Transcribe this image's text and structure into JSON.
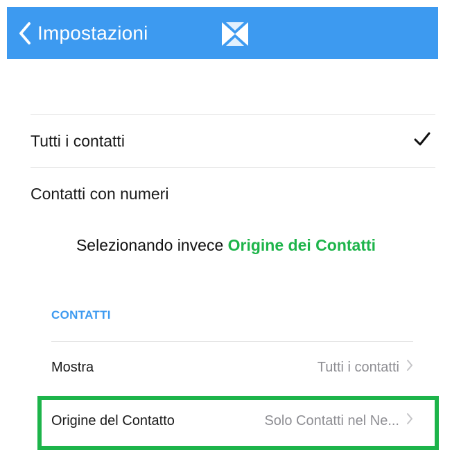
{
  "navbar": {
    "back_label": "Impostazioni",
    "color": "#3d9af0"
  },
  "options": [
    {
      "label": "Tutti i contatti",
      "checked": true
    },
    {
      "label": "Contatti con numeri",
      "checked": false
    }
  ],
  "caption": {
    "prefix": "Selezionando invece",
    "highlight": "Origine dei Contatti",
    "highlight_color": "#1db44a"
  },
  "settings": {
    "section_title": "CONTATTI",
    "rows": [
      {
        "label": "Mostra",
        "value": "Tutti i contatti"
      },
      {
        "label": "Origine del Contatto",
        "value": "Solo Contatti nel Ne..."
      }
    ]
  },
  "icons": {
    "back": "chevron-left-icon",
    "logo": "app-logo-icon",
    "check": "checkmark-icon",
    "disclosure": "chevron-right-icon"
  }
}
